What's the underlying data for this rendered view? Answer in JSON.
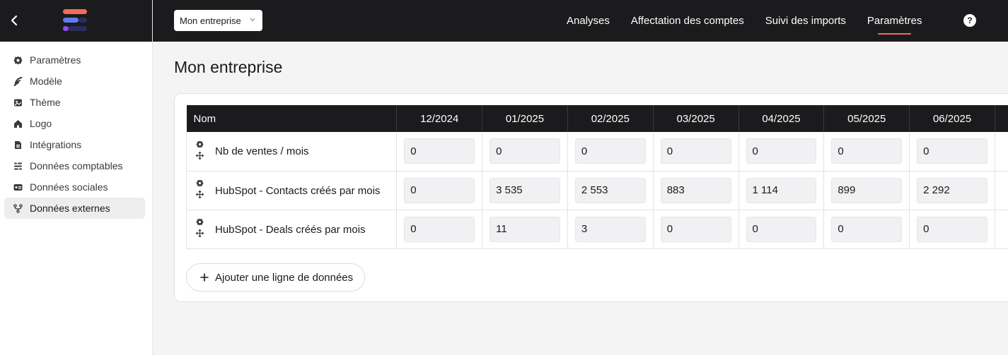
{
  "sidebar": {
    "items": [
      {
        "label": "Paramètres",
        "icon": "gear-icon"
      },
      {
        "label": "Modèle",
        "icon": "feather-icon"
      },
      {
        "label": "Thème",
        "icon": "image-icon"
      },
      {
        "label": "Logo",
        "icon": "home-icon"
      },
      {
        "label": "Intégrations",
        "icon": "file-icon"
      },
      {
        "label": "Données comptables",
        "icon": "list-icon"
      },
      {
        "label": "Données sociales",
        "icon": "id-card-icon"
      },
      {
        "label": "Données externes",
        "icon": "branch-icon",
        "active": true
      }
    ]
  },
  "topbar": {
    "company_select": "Mon entreprise",
    "nav": [
      "Analyses",
      "Affectation des comptes",
      "Suivi des imports",
      "Paramètres"
    ],
    "active_nav": "Paramètres",
    "help": "?"
  },
  "colors": {
    "dark": "#1b1b1d",
    "accent": "#f26b5b",
    "logo_red": "#f26b5b",
    "logo_blue": "#5b7cf2",
    "logo_purple": "#8a4cf2"
  },
  "page": {
    "title": "Mon entreprise"
  },
  "table": {
    "name_header": "Nom",
    "months": [
      "12/2024",
      "01/2025",
      "02/2025",
      "03/2025",
      "04/2025",
      "05/2025",
      "06/2025"
    ],
    "rows": [
      {
        "name": "Nb de ventes / mois",
        "values": [
          "0",
          "0",
          "0",
          "0",
          "0",
          "0",
          "0"
        ]
      },
      {
        "name": "HubSpot - Contacts créés par mois",
        "values": [
          "0",
          "3 535",
          "2 553",
          "883",
          "1 114",
          "899",
          "2 292"
        ]
      },
      {
        "name": "HubSpot - Deals créés par mois",
        "values": [
          "0",
          "11",
          "3",
          "0",
          "0",
          "0",
          "0"
        ]
      }
    ]
  },
  "add_row_label": "Ajouter une ligne de données"
}
